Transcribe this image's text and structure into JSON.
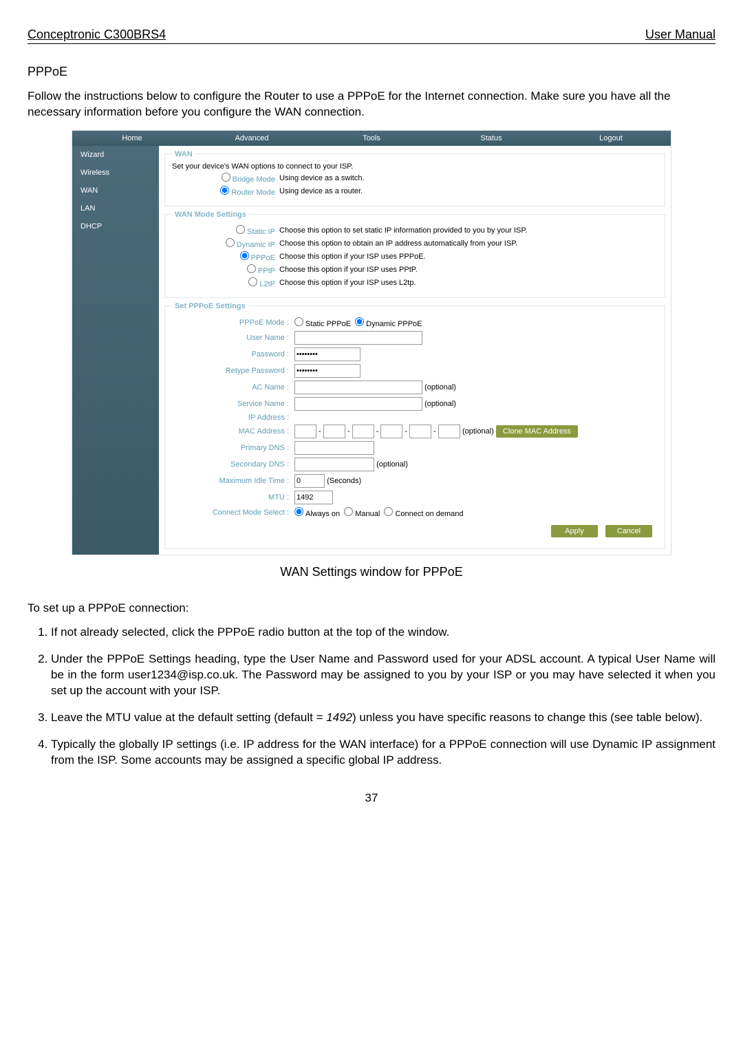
{
  "doc": {
    "header_left": "Conceptronic C300BRS4",
    "header_right": "User Manual",
    "section_title": "PPPoE",
    "intro": "Follow the instructions below to configure the Router to use a PPPoE for the Internet connection. Make sure you have all the necessary information before you configure the WAN connection.",
    "caption": "WAN Settings window for PPPoE",
    "setup_heading": "To set up a PPPoE connection:",
    "steps": [
      "If not already selected, click the PPPoE radio button at the top of the window.",
      "Under the PPPoE Settings heading, type the User Name and Password used for your ADSL account. A typical User Name will be in the form user1234@isp.co.uk. The Password may be assigned to you by your ISP or you may have selected it when you set up the account with your ISP.",
      "Leave the MTU value at the default setting (default = 1492) unless you have specific reasons to change this (see table below).",
      "Typically the globally IP settings (i.e. IP address for the WAN interface) for a PPPoE connection will use Dynamic IP assignment from the ISP. Some accounts may be assigned a specific global IP address."
    ],
    "step3_pre": "Leave the MTU value at the default setting (default = ",
    "step3_italic": "1492",
    "step3_post": ") unless you have specific reasons to change this (see table below).",
    "page_number": "37"
  },
  "nav": {
    "home": "Home",
    "advanced": "Advanced",
    "tools": "Tools",
    "status": "Status",
    "logout": "Logout"
  },
  "sidebar": {
    "wizard": "Wizard",
    "wireless": "Wireless",
    "wan": "WAN",
    "lan": "LAN",
    "dhcp": "DHCP"
  },
  "wan_panel": {
    "legend": "WAN",
    "desc": "Set your device's WAN options to connect to your ISP.",
    "bridge_label": "Bridge Mode",
    "bridge_desc": "Using device as a switch.",
    "router_label": "Router Mode",
    "router_desc": "Using device as a router."
  },
  "mode_panel": {
    "legend": "WAN Mode Settings",
    "rows": [
      {
        "label": "Static IP",
        "desc": "Choose this option to set static IP information provided to you by your ISP."
      },
      {
        "label": "Dynamic IP",
        "desc": "Choose this option to obtain an IP address automatically from your ISP."
      },
      {
        "label": "PPPoE",
        "desc": "Choose this option if your ISP uses PPPoE."
      },
      {
        "label": "PPtP",
        "desc": "Choose this option if your ISP uses PPtP."
      },
      {
        "label": "L2tP",
        "desc": "Choose this option if your ISP uses L2tp."
      }
    ]
  },
  "pppoe_panel": {
    "legend": "Set PPPoE Settings",
    "mode_label": "PPPoE Mode :",
    "mode_static": "Static PPPoE",
    "mode_dynamic": "Dynamic PPPoE",
    "user_label": "User Name :",
    "pass_label": "Password :",
    "retype_label": "Retype Password :",
    "ac_label": "AC Name :",
    "svc_label": "Service Name :",
    "ip_label": "IP Address :",
    "mac_label": "MAC Address :",
    "clone_btn": "Clone MAC Address",
    "pdns_label": "Primary DNS :",
    "sdns_label": "Secondary DNS :",
    "idle_label": "Maximum Idle Time :",
    "idle_value": "0",
    "idle_unit": "(Seconds)",
    "mtu_label": "MTU :",
    "mtu_value": "1492",
    "conn_label": "Connect Mode Select :",
    "conn_always": "Always on",
    "conn_manual": "Manual",
    "conn_demand": "Connect on demand",
    "optional": "(optional)",
    "pass_value": "••••••••",
    "retype_value": "••••••••"
  },
  "buttons": {
    "apply": "Apply",
    "cancel": "Cancel"
  }
}
